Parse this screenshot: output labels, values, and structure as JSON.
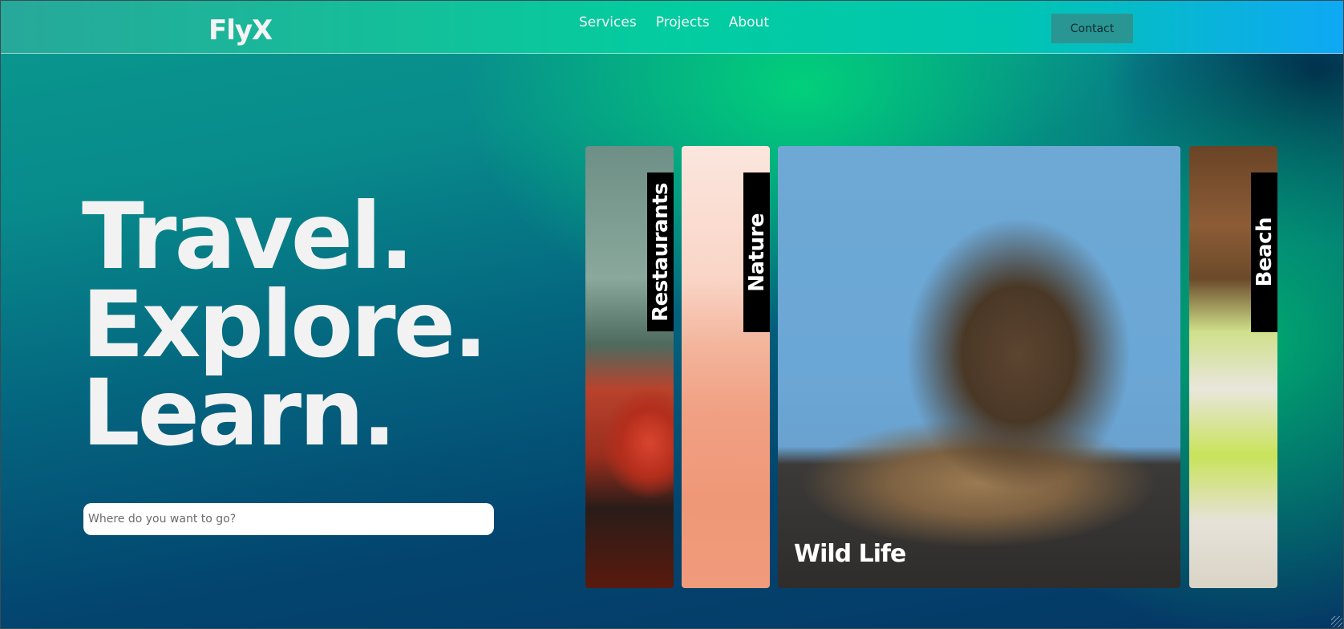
{
  "header": {
    "logo": "FlyX",
    "nav": [
      {
        "label": "Services"
      },
      {
        "label": "Projects"
      },
      {
        "label": "About"
      }
    ],
    "contact_label": "Contact"
  },
  "hero": {
    "lines": [
      "Travel.",
      "Explore.",
      "Learn."
    ],
    "search_placeholder": "Where do you want to go?"
  },
  "cards": {
    "restaurants": "Restaurants",
    "nature": "Nature",
    "wildlife": "Wild Life",
    "beach": "Beach"
  },
  "colors": {
    "header_left": "#27a89a",
    "header_right": "#0fa8f5",
    "contact_button": "#2a9694",
    "headline_text": "#f2f2f2"
  }
}
